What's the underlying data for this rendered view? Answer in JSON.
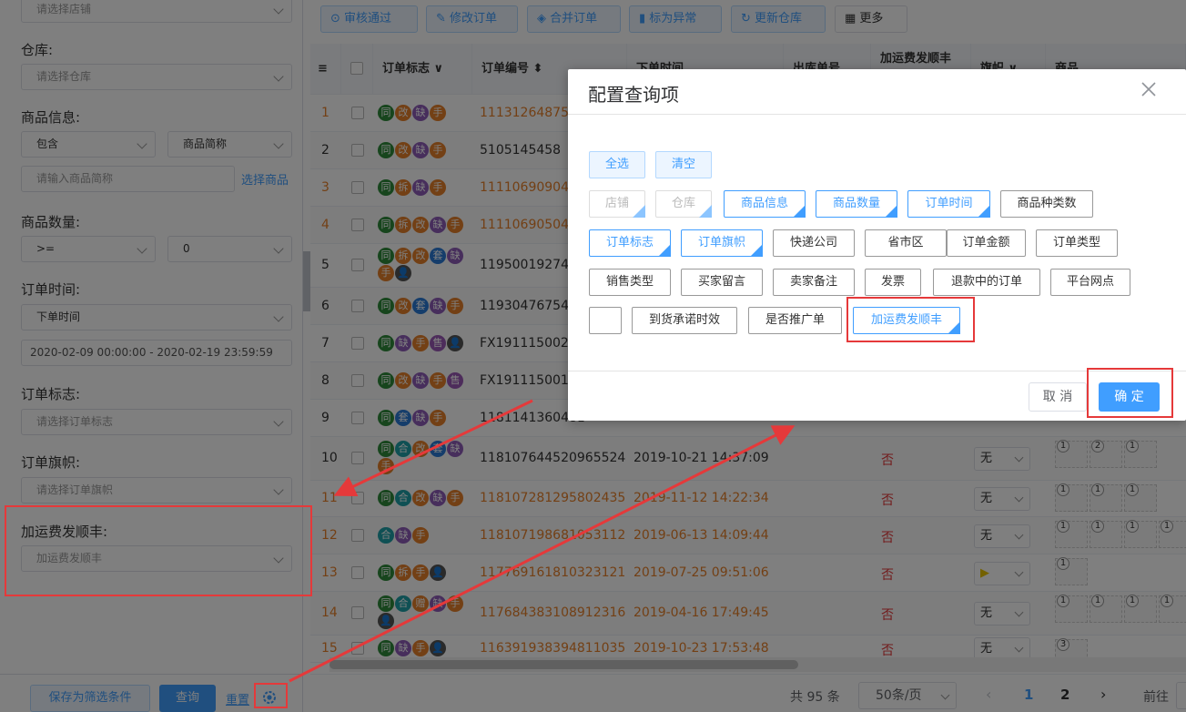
{
  "sidebar": {
    "shop_placeholder": "请选择店铺",
    "warehouse_label": "仓库:",
    "warehouse_placeholder": "请选择仓库",
    "goods_label": "商品信息:",
    "goods_mode": "包含",
    "goods_field": "商品简称",
    "goods_placeholder": "请输入商品简称",
    "goods_link": "选择商品",
    "qty_label": "商品数量:",
    "qty_op": ">=",
    "qty_value": "0",
    "time_label": "订单时间:",
    "time_type": "下单时间",
    "time_range": "2020-02-09 00:00:00 - 2020-02-19 23:59:59",
    "mark_label": "订单标志:",
    "mark_placeholder": "请选择订单标志",
    "flag_label": "订单旗帜:",
    "flag_placeholder": "请选择订单旗帜",
    "sf_label": "加运费发顺丰:",
    "sf_placeholder": "加运费发顺丰",
    "save_btn": "保存为筛选条件",
    "query_btn": "查询",
    "reset_btn": "重置"
  },
  "toolbar": {
    "approve": "审核通过",
    "edit": "修改订单",
    "merge": "合并订单",
    "mark_abnormal": "标为异常",
    "update_wh": "更新仓库",
    "more": "更多"
  },
  "table": {
    "headers": [
      "订单标志",
      "订单编号",
      "下单时间",
      "出库单号",
      "加运费发顺丰",
      "旗帜",
      "商品"
    ],
    "rows": [
      {
        "no": "1",
        "tags": [
          "同",
          "改",
          "缺",
          "手"
        ],
        "order": "111312648754",
        "time": "",
        "sf": "",
        "flag": ""
      },
      {
        "no": "2",
        "tags": [
          "同",
          "改",
          "缺",
          "手"
        ],
        "order": "5105145458",
        "time": "",
        "sf": "",
        "flag": ""
      },
      {
        "no": "3",
        "tags": [
          "同",
          "拆",
          "缺",
          "手"
        ],
        "order": "111106909042",
        "time": "",
        "sf": "",
        "flag": ""
      },
      {
        "no": "4",
        "tags": [
          "同",
          "拆",
          "改",
          "缺",
          "手"
        ],
        "order": "111106905045",
        "time": "",
        "sf": "",
        "flag": ""
      },
      {
        "no": "5",
        "tags": [
          "同",
          "拆",
          "改",
          "套",
          "缺",
          "手",
          "👤"
        ],
        "order": "1195001927466",
        "time": "",
        "sf": "",
        "flag": ""
      },
      {
        "no": "6",
        "tags": [
          "同",
          "改",
          "套",
          "缺",
          "手"
        ],
        "order": "119304767546",
        "time": "",
        "sf": "",
        "flag": ""
      },
      {
        "no": "7",
        "tags": [
          "同",
          "缺",
          "手",
          "售",
          "👤"
        ],
        "order": "FX191115002",
        "time": "",
        "sf": "",
        "flag": ""
      },
      {
        "no": "8",
        "tags": [
          "同",
          "改",
          "缺",
          "手",
          "售"
        ],
        "order": "FX191115001",
        "time": "",
        "sf": "",
        "flag": ""
      },
      {
        "no": "9",
        "tags": [
          "同",
          "套",
          "缺",
          "手"
        ],
        "order": "1181141360481",
        "time": "",
        "sf": "",
        "flag": ""
      },
      {
        "no": "10",
        "tags": [
          "同",
          "合",
          "改",
          "套",
          "缺",
          "手"
        ],
        "order": "118107644520965524",
        "time": "2019-10-21 14:37:09",
        "sf": "否",
        "flag": "无",
        "thumbs": [
          "1",
          "2",
          "1"
        ]
      },
      {
        "no": "11",
        "tags": [
          "同",
          "合",
          "改",
          "缺",
          "手"
        ],
        "order": "118107281295802435",
        "time": "2019-11-12 14:22:34",
        "sf": "否",
        "flag": "无",
        "thumbs": [
          "1",
          "1",
          "1"
        ]
      },
      {
        "no": "12",
        "tags": [
          "合",
          "缺",
          "手"
        ],
        "order": "118107198681053112",
        "time": "2019-06-13 14:09:44",
        "sf": "否",
        "flag": "无",
        "thumbs": [
          "1",
          "1",
          "1",
          "1"
        ]
      },
      {
        "no": "13",
        "tags": [
          "同",
          "拆",
          "手",
          "👤"
        ],
        "order": "117769161810323121",
        "time": "2019-07-25 09:51:06",
        "sf": "否",
        "flag": "",
        "thumbs": [
          "1"
        ]
      },
      {
        "no": "14",
        "tags": [
          "同",
          "合",
          "赠",
          "缺",
          "手",
          "👤"
        ],
        "order": "117684383108912316",
        "time": "2019-04-16 17:49:45",
        "sf": "否",
        "flag": "无",
        "thumbs": [
          "1",
          "1",
          "1",
          "1"
        ]
      },
      {
        "no": "15",
        "tags": [
          "同",
          "缺",
          "手",
          "👤"
        ],
        "order": "116391938394811035",
        "time": "2019-10-23 17:53:48",
        "sf": "否",
        "flag": "无",
        "thumbs": [
          "3"
        ]
      }
    ]
  },
  "pagination": {
    "total": "共 95 条",
    "page_size": "50条/页",
    "pages": [
      "1",
      "2"
    ],
    "goto": "前往"
  },
  "dialog": {
    "title": "配置查询项",
    "select_all": "全选",
    "clear": "清空",
    "options": [
      {
        "label": "店铺",
        "state": "dis"
      },
      {
        "label": "仓库",
        "state": "dis"
      },
      {
        "label": "商品信息",
        "state": "on"
      },
      {
        "label": "商品数量",
        "state": "on"
      },
      {
        "label": "订单时间",
        "state": "on"
      },
      {
        "label": "商品种类数",
        "state": "off"
      },
      {
        "label": "订单标志",
        "state": "on"
      },
      {
        "label": "订单旗帜",
        "state": "on"
      },
      {
        "label": "快递公司",
        "state": "off"
      },
      {
        "label": "省市区",
        "state": "off"
      },
      {
        "label": "订单金额",
        "state": "off"
      },
      {
        "label": "订单类型",
        "state": "off"
      },
      {
        "label": "销售类型",
        "state": "off"
      },
      {
        "label": "买家留言",
        "state": "off"
      },
      {
        "label": "卖家备注",
        "state": "off"
      },
      {
        "label": "发票",
        "state": "off"
      },
      {
        "label": "退款中的订单",
        "state": "off"
      },
      {
        "label": "平台网点",
        "state": "off"
      },
      {
        "label": "",
        "state": "off"
      },
      {
        "label": "到货承诺时效",
        "state": "off"
      },
      {
        "label": "是否推广单",
        "state": "off"
      },
      {
        "label": "加运费发顺丰",
        "state": "on"
      }
    ],
    "cancel": "取 消",
    "confirm": "确 定"
  },
  "colors": {
    "accent": "#409eff",
    "annotation": "#e5393a",
    "orange_text": "#e6802a"
  }
}
